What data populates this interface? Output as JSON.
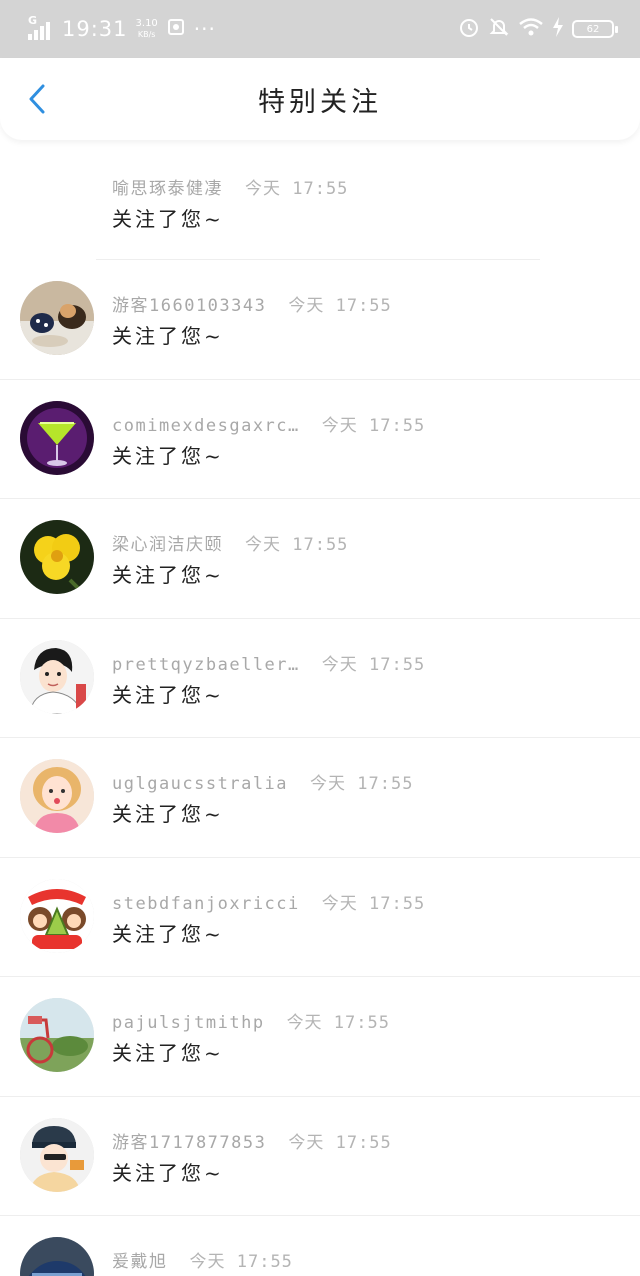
{
  "status_bar": {
    "network": "G",
    "time": "19:31",
    "speed_value": "3.10",
    "speed_unit": "KB/s",
    "more": "···",
    "battery": "62"
  },
  "header": {
    "title": "特别关注"
  },
  "notifications": [
    {
      "name": "喻思琢泰健凄",
      "time": "今天 17:55",
      "text": "关注了您~"
    },
    {
      "name": "游客1660103343",
      "time": "今天 17:55",
      "text": "关注了您~"
    },
    {
      "name": "comimexdesgaxrc…",
      "time": "今天 17:55",
      "text": "关注了您~"
    },
    {
      "name": "梁心润洁庆颐",
      "time": "今天 17:55",
      "text": "关注了您~"
    },
    {
      "name": "prettqyzbaeller…",
      "time": "今天 17:55",
      "text": "关注了您~"
    },
    {
      "name": "uglgaucsstralia",
      "time": "今天 17:55",
      "text": "关注了您~"
    },
    {
      "name": "stebdfanjoxricci",
      "time": "今天 17:55",
      "text": "关注了您~"
    },
    {
      "name": "pajulsjtmithp",
      "time": "今天 17:55",
      "text": "关注了您~"
    },
    {
      "name": "游客1717877853",
      "time": "今天 17:55",
      "text": "关注了您~"
    },
    {
      "name": "爰戴旭",
      "time": "今天 17:55",
      "text": ""
    }
  ],
  "colors": {
    "status_bar_bg": "#d4d4d4",
    "back_arrow": "#2f8fe0",
    "meta_text": "#a8a8a8"
  }
}
